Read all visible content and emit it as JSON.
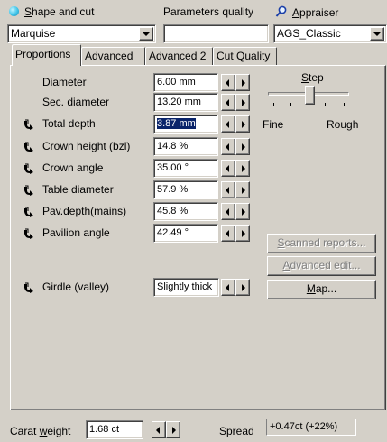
{
  "header": {
    "shape_label_prefix": "",
    "shape_label_u": "S",
    "shape_label_rest": "hape and cut",
    "quality_label": "Parameters quality",
    "appraiser_label_u": "A",
    "appraiser_label_rest": "ppraiser",
    "shape_value": "Marquise",
    "quality_value": "",
    "appraiser_value": "AGS_Classic"
  },
  "tabs": [
    {
      "label": "Proportions"
    },
    {
      "label": "Advanced"
    },
    {
      "label": "Advanced 2"
    },
    {
      "label": "Cut Quality"
    }
  ],
  "params": [
    {
      "label": "Diameter",
      "value": "6.00 mm",
      "lock": false
    },
    {
      "label": "Sec. diameter",
      "value": "13.20 mm",
      "lock": false
    },
    {
      "label": "Total depth",
      "value": "3.87 mm",
      "lock": true,
      "selected": true
    },
    {
      "label": "Crown height (bzl)",
      "value": "14.8 %",
      "lock": true
    },
    {
      "label": "Crown angle",
      "value": "35.00 °",
      "lock": true
    },
    {
      "label": "Table diameter",
      "value": "57.9 %",
      "lock": true
    },
    {
      "label": "Pav.depth(mains)",
      "value": "45.8 %",
      "lock": true
    },
    {
      "label": "Pavilion angle",
      "value": "42.49 °",
      "lock": true
    },
    {
      "label": "Girdle (valley)",
      "value": "Slightly thick",
      "lock": true
    }
  ],
  "step": {
    "label_u": "S",
    "label_rest": "tep",
    "fine_label": "Fine",
    "rough_label": "Rough"
  },
  "buttons": {
    "scanned_u": "S",
    "scanned_rest": "canned reports...",
    "advanced_u": "A",
    "advanced_rest": "dvanced edit...",
    "map_u": "M",
    "map_rest": "ap..."
  },
  "footer": {
    "carat_prefix": "Carat ",
    "carat_u": "w",
    "carat_rest": "eight",
    "carat_value": "1.68 ct",
    "spread_label": "Spread",
    "spread_value": "+0.47ct (+22%)"
  },
  "colors": {
    "face": "#d4d0c8",
    "selection": "#0a246a"
  }
}
